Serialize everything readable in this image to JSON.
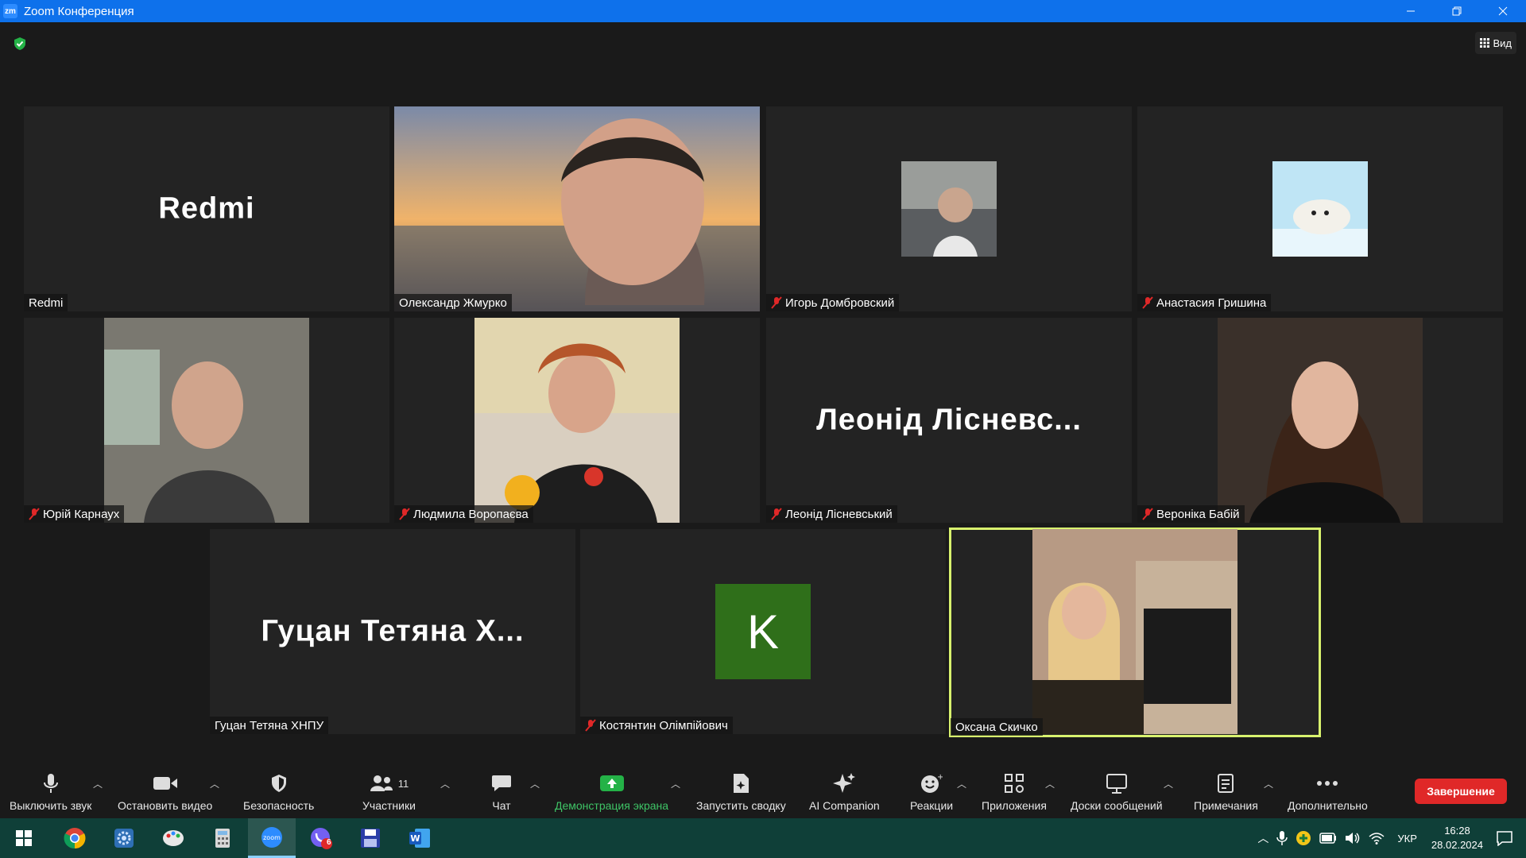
{
  "window": {
    "title": "Zoom Конференция"
  },
  "header": {
    "view_label": "Вид"
  },
  "tiles": [
    {
      "name": "Redmi",
      "big_name": "Redmi",
      "muted": false
    },
    {
      "name": "Олександр Жмурко",
      "muted": false
    },
    {
      "name": "Игорь Домбровский",
      "muted": true
    },
    {
      "name": "Анастасия Гришина",
      "muted": true
    },
    {
      "name": "Юрій Карнаух",
      "muted": true
    },
    {
      "name": "Людмила Воропаєва",
      "muted": true
    },
    {
      "name": "Леонід Лісневський",
      "big_name": "Леонід Лісневс...",
      "muted": true
    },
    {
      "name": "Вероніка Бабій",
      "muted": true
    },
    {
      "name": "Гуцан Тетяна ХНПУ",
      "big_name": "Гуцан Тетяна Х...",
      "muted": false
    },
    {
      "name": "Костянтин Олімпійович",
      "avatar_letter": "K",
      "avatar_color": "#2f6f1a",
      "muted": true
    },
    {
      "name": "Оксана Скичко",
      "muted": false,
      "active_speaker": true
    }
  ],
  "toolbar": {
    "mute_label": "Выключить звук",
    "video_label": "Остановить видео",
    "security_label": "Безопасность",
    "participants_label": "Участники",
    "participants_count": "11",
    "chat_label": "Чат",
    "share_label": "Демонстрация экрана",
    "summary_label": "Запустить сводку",
    "ai_label": "AI Companion",
    "reactions_label": "Реакции",
    "apps_label": "Приложения",
    "whiteboards_label": "Доски сообщений",
    "notes_label": "Примечания",
    "more_label": "Дополнительно",
    "end_label": "Завершение"
  },
  "taskbar": {
    "viber_badge": "6",
    "lang": "УКР",
    "time": "16:28",
    "date": "28.02.2024"
  },
  "colors": {
    "accent": "#0e71eb",
    "active_border": "#d8f26e",
    "share_green": "#3ec466",
    "end_red": "#e02828"
  }
}
